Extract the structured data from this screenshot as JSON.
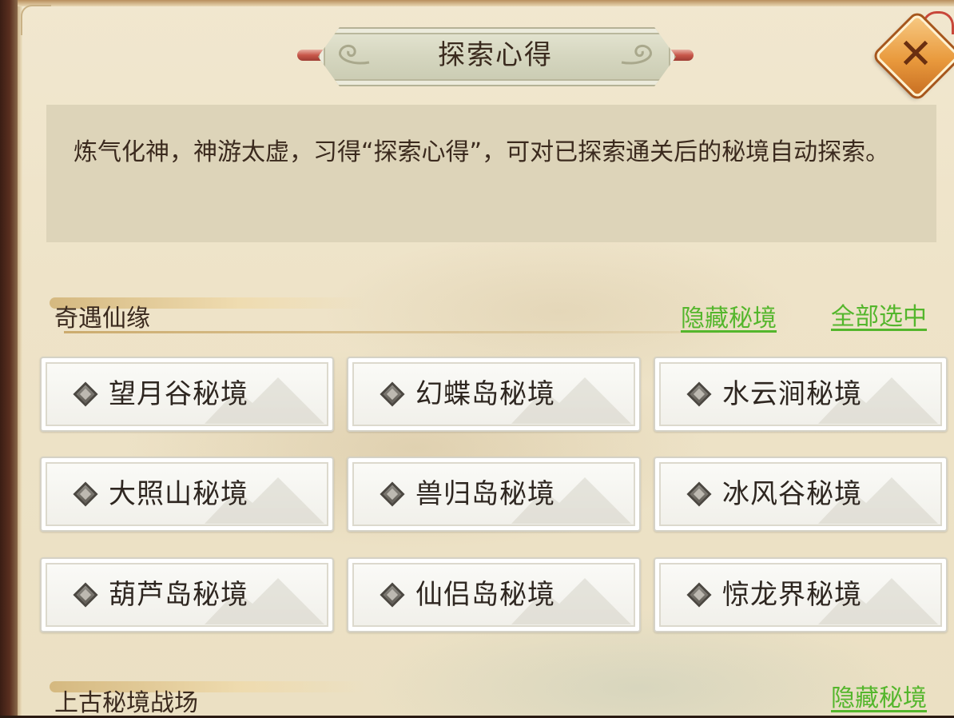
{
  "dialog": {
    "title": "探索心得",
    "close_label": "✕",
    "description": "炼气化神，神游太虚，习得“探索心得”，可对已探索通关后的秘境自动探索。"
  },
  "sections": [
    {
      "title": "奇遇仙缘",
      "hide_label": "隐藏秘境",
      "select_all_label": "全部选中",
      "realms": [
        "望月谷秘境",
        "幻蝶岛秘境",
        "水云涧秘境",
        "大照山秘境",
        "兽归岛秘境",
        "冰风谷秘境",
        "葫芦岛秘境",
        "仙侣岛秘境",
        "惊龙界秘境"
      ]
    },
    {
      "title": "上古秘境战场",
      "hide_label": "隐藏秘境"
    }
  ],
  "colors": {
    "link_green": "#54b62c",
    "close_orange": "#e99a3d",
    "text_brown": "#3b2a1e"
  }
}
